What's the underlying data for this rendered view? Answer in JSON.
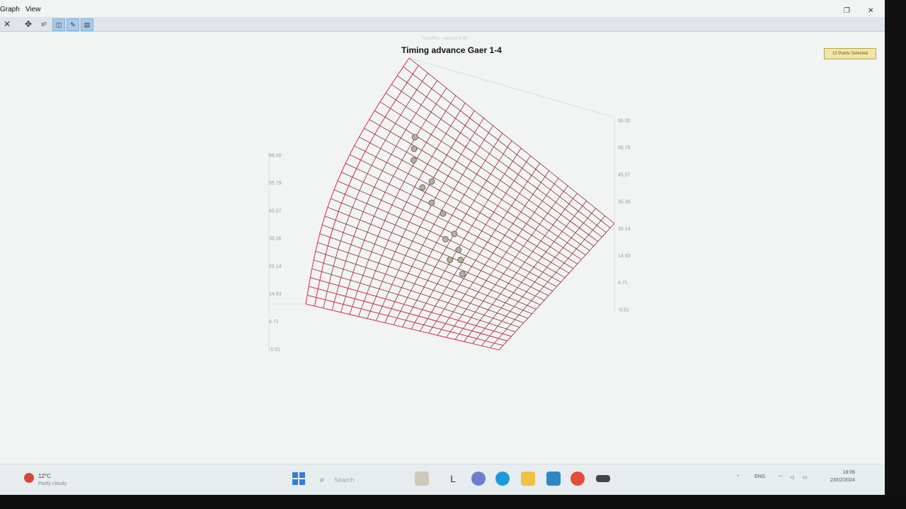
{
  "window": {
    "menu": [
      "Graph",
      "View"
    ],
    "toolbar_icons": [
      "close-icon",
      "move-icon",
      "formula-icon",
      "view-3d-icon",
      "edit-chart-icon",
      "table-icon"
    ]
  },
  "chart": {
    "subtitle": "TunerPro – version 5.00",
    "title": "Timing advance Gaer 1-4",
    "points_selected": "13 Points Selected",
    "left_axis_ticks": [
      "66.00",
      "55.79",
      "45.57",
      "35.36",
      "25.14",
      "14.93",
      "4.71",
      "-5.51"
    ],
    "right_axis_ticks": [
      "66.00",
      "55.79",
      "45.57",
      "35.36",
      "25.14",
      "14.93",
      "4.71",
      "-5.51"
    ],
    "mesh_color": "#8b2b35",
    "highlight_color": "#d6395a"
  },
  "chart_data": {
    "type": "surface",
    "title": "Timing advance Gaer 1-4",
    "zlim": [
      -5.51,
      66.0
    ],
    "z_ticks": [
      66.0,
      55.79,
      45.57,
      35.36,
      25.14,
      14.93,
      4.71,
      -5.51
    ],
    "selected_points": 13
  },
  "taskbar": {
    "weather_temp": "12°C",
    "weather_cond": "Partly cloudy",
    "search_placeholder": "Search",
    "lang": "ENG",
    "time": "18:06",
    "date": "23/02/2024"
  }
}
